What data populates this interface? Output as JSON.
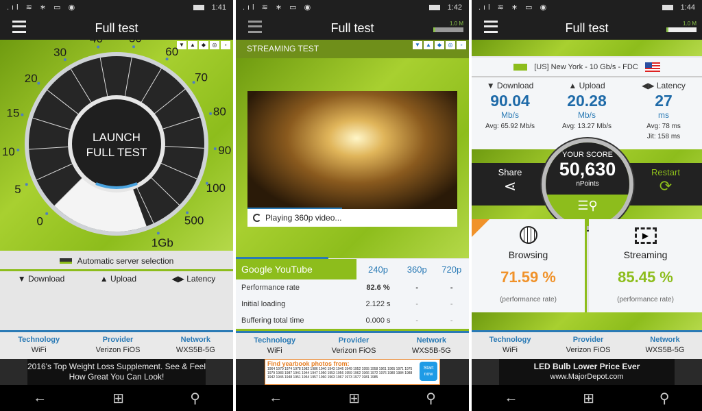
{
  "colors": {
    "accent_green": "#8dbd1c",
    "blue": "#2a7ab5",
    "orange": "#f0922a",
    "dark": "#1f1f1f"
  },
  "status_icons": "signal wifi bluetooth message location",
  "panels": [
    {
      "time": "1:41",
      "title": "Full test",
      "toolbar": [
        "▼",
        "▲",
        "◆",
        "◎",
        "▫"
      ],
      "gauge": {
        "center_line1": "LAUNCH",
        "center_line2": "FULL TEST",
        "scale": [
          "0",
          "5",
          "10",
          "15",
          "20",
          "30",
          "40",
          "50",
          "60",
          "70",
          "80",
          "90",
          "100",
          "500",
          "1Gb"
        ]
      },
      "server": "Automatic server selection",
      "metrics": {
        "download": "Download",
        "upload": "Upload",
        "latency": "Latency"
      }
    },
    {
      "time": "1:42",
      "title": "Full test",
      "mini_label": "1.0 M",
      "section": "STREAMING TEST",
      "toolbar": [
        "▼",
        "▲",
        "◆",
        "◎",
        "▫"
      ],
      "video_status": "Playing 360p video...",
      "video_progress": 0.45,
      "table": {
        "service": "Google YouTube",
        "columns": [
          "240p",
          "360p",
          "720p"
        ],
        "rows": [
          {
            "label": "Performance rate",
            "values": [
              "82.6 %",
              "-",
              "-"
            ]
          },
          {
            "label": "Initial loading",
            "values": [
              "2.122 s",
              "-",
              "-"
            ]
          },
          {
            "label": "Buffering total time",
            "values": [
              "0.000 s",
              "-",
              "-"
            ]
          }
        ]
      },
      "ad": {
        "headline": "Find yearbook photos from:",
        "years": "1964 1970 1974 1978 1982 1986 1940 1943 1946 1949 1952 1955 1958 1961 1965 1971 1975 1979 1983 1987 1941 1944 1947 1950 1953 1956 1959 1962 1966 1972 1976 1980 1984 1988 1942 1945 1948 1951 1954 1957 1960 1963 1967 1973 1977 1981 1985",
        "cta": "Start now"
      }
    },
    {
      "time": "1:44",
      "title": "Full test",
      "mini_label": "1.0 M",
      "server": "[US] New York - 10 Gb/s - FDC",
      "download": {
        "label": "Download",
        "value": "90.04",
        "unit": "Mb/s",
        "avg": "Avg: 65.92 Mb/s"
      },
      "upload": {
        "label": "Upload",
        "value": "20.28",
        "unit": "Mb/s",
        "avg": "Avg: 13.27 Mb/s"
      },
      "latency": {
        "label": "Latency",
        "value": "27",
        "unit": "ms",
        "avg": "Avg: 78 ms",
        "jitter": "Jit: 158 ms"
      },
      "score": {
        "title": "YOUR SCORE",
        "value": "50,630",
        "unit": "nPoints"
      },
      "share": "Share",
      "restart": "Restart",
      "browsing": {
        "label": "Browsing",
        "value": "71.59 %",
        "note": "(performance rate)"
      },
      "streaming": {
        "label": "Streaming",
        "value": "85.45 %",
        "note": "(performance rate)"
      },
      "ad": {
        "line1": "LED Bulb Lower Price Ever",
        "line2": "www.MajorDepot.com"
      }
    }
  ],
  "network_info": {
    "technology_label": "Technology",
    "technology": "WiFi",
    "provider_label": "Provider",
    "provider": "Verizon FiOS",
    "network_label": "Network",
    "network": "WXS5B-5G"
  },
  "ad1": {
    "line1": "2016's Top Weight Loss Supplement. See & Feel",
    "line2": "How Great You Can Look!"
  },
  "nav": {
    "back": "←",
    "home": "⊞",
    "search": "⚲"
  }
}
